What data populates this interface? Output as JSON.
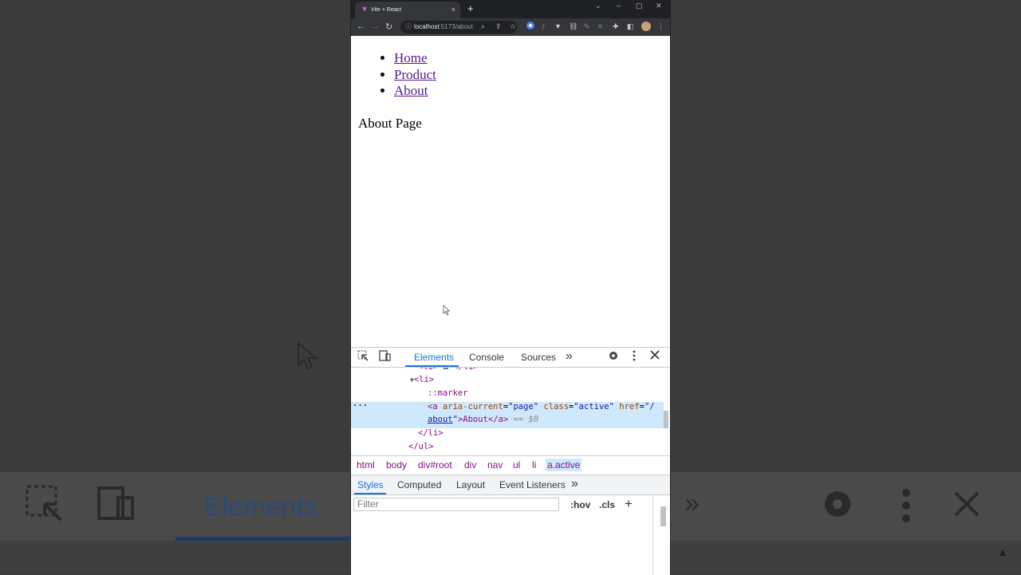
{
  "browser": {
    "tab_title": "Vite + React",
    "tab_close": "×",
    "new_tab": "+",
    "url_host": "localhost",
    "url_path": ":5173/about",
    "window_controls": [
      "⌄",
      "–",
      "▢",
      "✕"
    ]
  },
  "page": {
    "nav_links": [
      "Home",
      "Product",
      "About"
    ],
    "heading": "About Page"
  },
  "devtools": {
    "tabs": [
      "Elements",
      "Console",
      "Sources"
    ],
    "more_tabs": "»",
    "dom_lines": {
      "li_open": "<li>",
      "marker": "::marker",
      "a_tag_part1": "<a ",
      "a_attr1": "aria-current",
      "a_val1": "\"page\"",
      "a_attr2": "class",
      "a_val2": "\"active\"",
      "a_attr3": "href",
      "a_val3_part1": "\"/",
      "a_val3_part2": "about",
      "a_text": ">About</a>",
      "eq": "== $0",
      "li_close": "</li>",
      "ul_close": "</ul>"
    },
    "breadcrumbs": [
      "html",
      "body",
      "div#root",
      "div",
      "nav",
      "ul",
      "li",
      "a.active"
    ],
    "subtabs": [
      "Styles",
      "Computed",
      "Layout",
      "Event Listeners"
    ],
    "filter_placeholder": "Filter",
    "hov": ":hov",
    "cls": ".cls",
    "plus": "+"
  },
  "background_zoom": {
    "elements_label": "Elements"
  }
}
